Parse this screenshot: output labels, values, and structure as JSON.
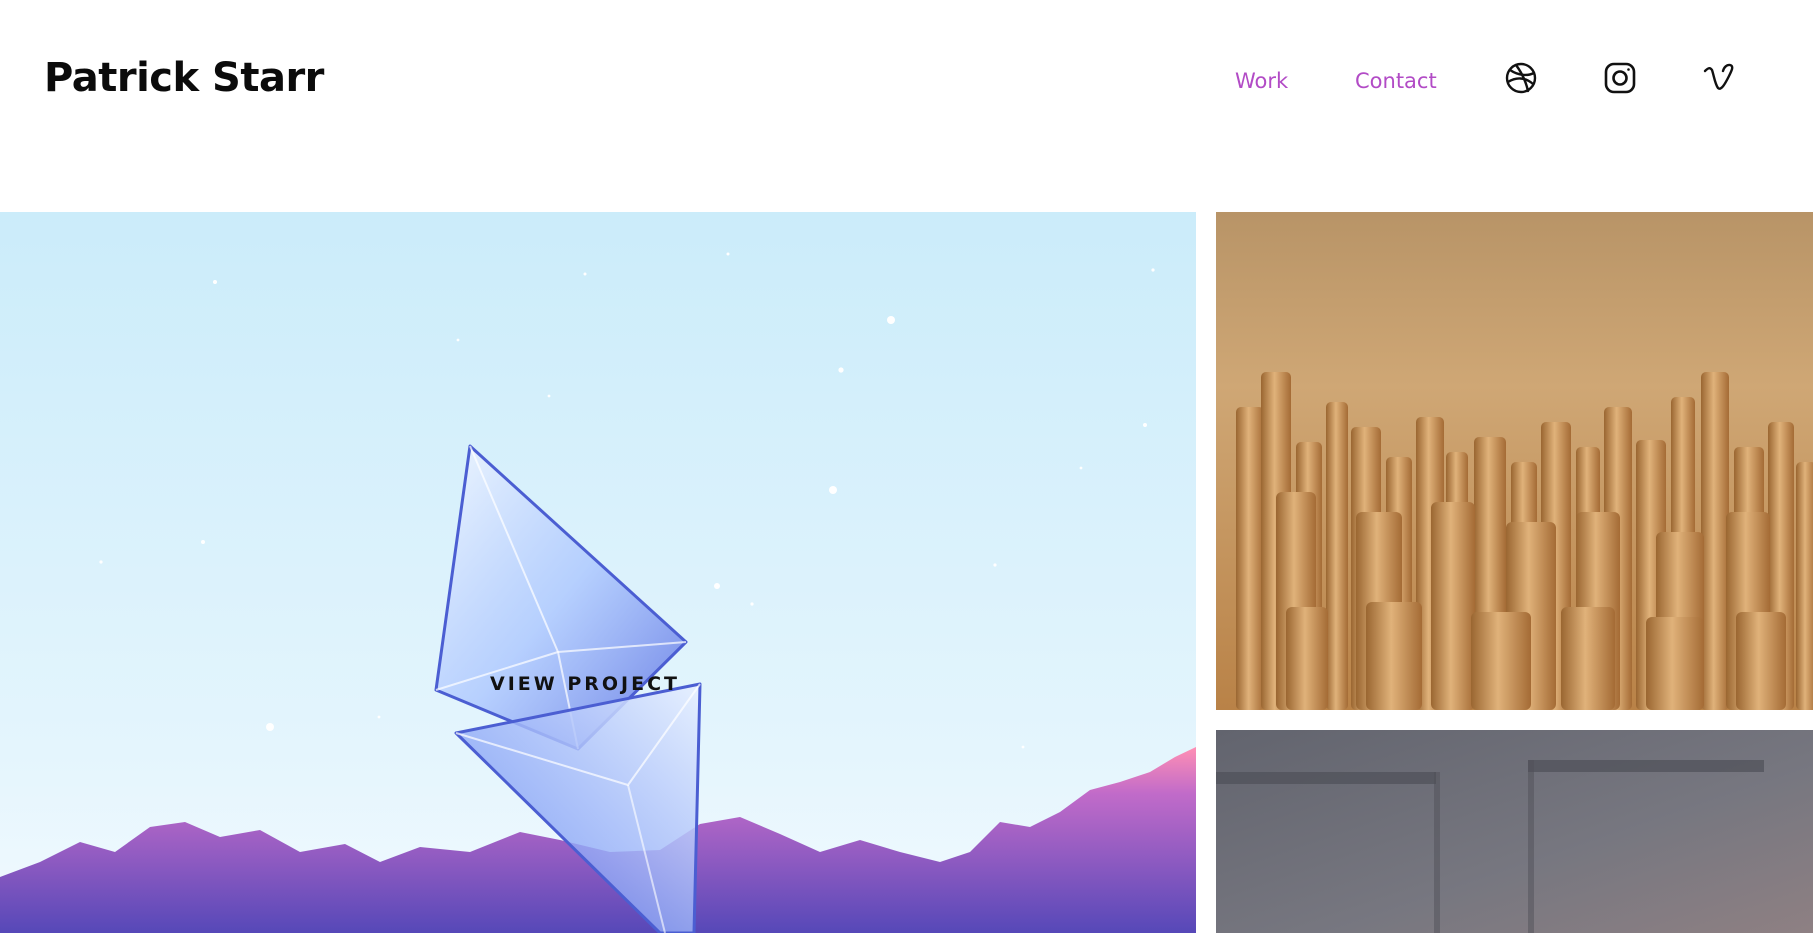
{
  "header": {
    "brand": "Patrick Starr",
    "nav": [
      {
        "label": "Work"
      },
      {
        "label": "Contact"
      }
    ],
    "social": [
      "dribbble-icon",
      "instagram-icon",
      "vimeo-icon"
    ],
    "accent_color": "#b24bc6"
  },
  "projects": [
    {
      "overlay_label": "VIEW PROJECT",
      "artwork": "crystal-diamond-over-mountains"
    },
    {
      "artwork": "golden-cylinders-with-letters"
    },
    {
      "artwork": "gray-interior-panels"
    }
  ]
}
